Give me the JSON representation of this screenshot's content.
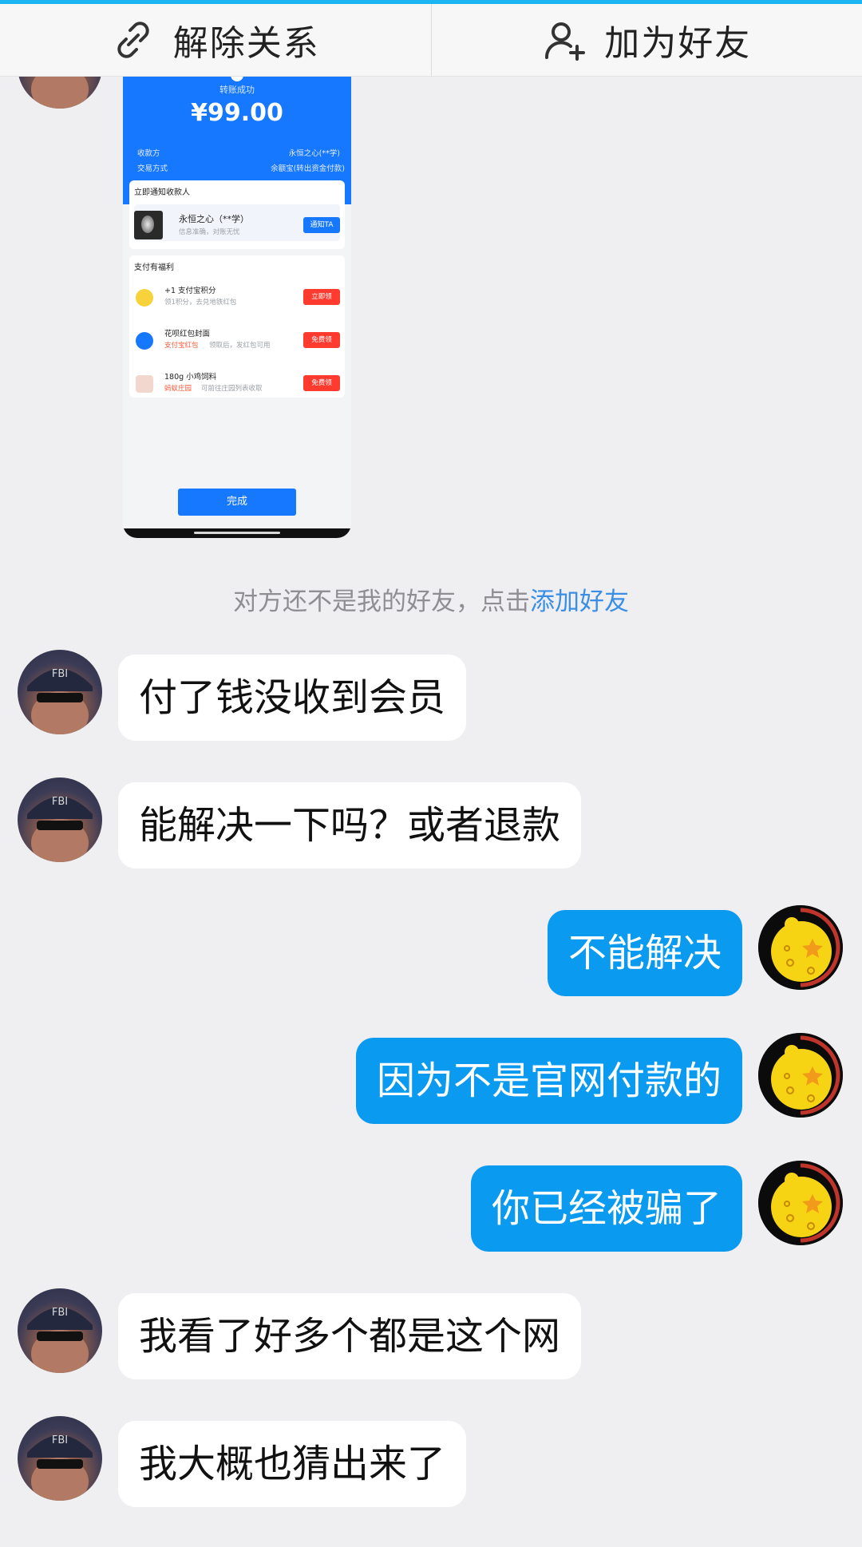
{
  "topbar": {
    "unlink_label": "解除关系",
    "add_friend_label": "加为好友"
  },
  "image_message": {
    "status_text": "转账成功",
    "amount": "¥99.00",
    "payee_label": "收款方",
    "payee_value": "永恒之心(**学)",
    "method_label": "交易方式",
    "method_value": "余额宝(转出资金付款)",
    "notify_title": "立即通知收款人",
    "notify_name": "永恒之心（**学）",
    "notify_sub": "信息准确，对账无忧",
    "notify_button": "通知TA",
    "benefits_title": "支付有福利",
    "benefit_1_title": "+1 支付宝积分",
    "benefit_1_sub": "领1积分，去兑地铁红包",
    "benefit_1_button": "立即领",
    "benefit_2_title": "花呗红包封面",
    "benefit_2_tag": "支付宝红包",
    "benefit_2_sub": "领取后，发红包可用",
    "benefit_2_button": "免费领",
    "benefit_3_title": "180g 小鸡饲料",
    "benefit_3_tag": "蚂蚁庄园",
    "benefit_3_sub": "可前往庄园列表收取",
    "benefit_3_button": "免费领",
    "done_button": "完成"
  },
  "system_notice": {
    "text": "对方还不是我的好友，点击",
    "link": "添加好友"
  },
  "messages": [
    {
      "side": "in",
      "text": "付了钱没收到会员"
    },
    {
      "side": "in",
      "text": "能解决一下吗？或者退款"
    },
    {
      "side": "out",
      "text": "不能解决"
    },
    {
      "side": "out",
      "text": "因为不是官网付款的"
    },
    {
      "side": "out",
      "text": "你已经被骗了"
    },
    {
      "side": "in",
      "text": "我看了好多个都是这个网"
    },
    {
      "side": "in",
      "text": "我大概也猜出来了"
    }
  ],
  "colors": {
    "accent": "#19b6f2",
    "outgoing_bubble": "#0a9af0",
    "link": "#3a8ee6",
    "alipay_blue": "#1677ff"
  }
}
